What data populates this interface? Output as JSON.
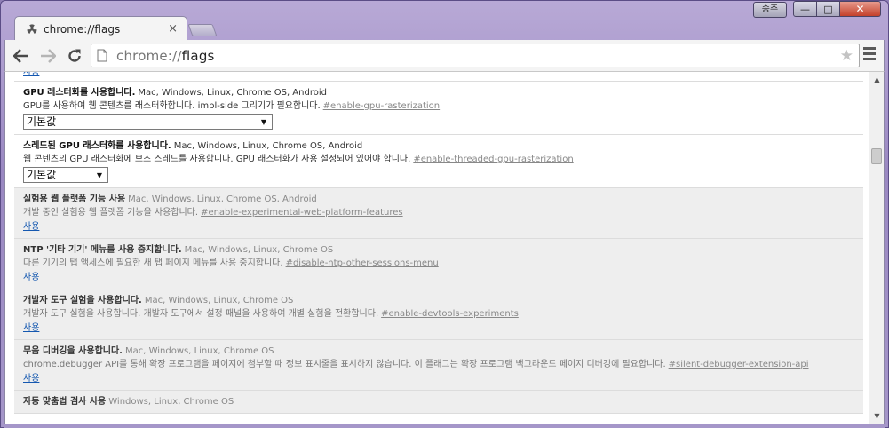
{
  "window": {
    "user_badge": "송주",
    "minimize": "—",
    "maximize": "□",
    "close": "✕"
  },
  "tab": {
    "title": "chrome://flags",
    "close": "×"
  },
  "toolbar": {
    "url_scheme": "chrome://",
    "url_host": "flags"
  },
  "flags": {
    "partial_top_link": "사용",
    "items": [
      {
        "title": "GPU 래스터화를 사용합니다.",
        "platforms": "Mac, Windows, Linux, Chrome OS, Android",
        "description": "GPU를 사용하여 웹 콘텐츠를 래스터화합니다. impl-side 그리기가 필요합니다.",
        "hash": "#enable-gpu-rasterization",
        "control": "select",
        "select_value": "기본값"
      },
      {
        "title": "스레드된 GPU 래스터화를 사용합니다.",
        "platforms": "Mac, Windows, Linux, Chrome OS, Android",
        "description": "웹 콘텐츠의 GPU 래스터화에 보조 스레드를 사용합니다. GPU 래스터화가 사용 설정되어 있어야 합니다.",
        "hash": "#enable-threaded-gpu-rasterization",
        "control": "select",
        "select_value": "기본값"
      },
      {
        "title": "실험용 웹 플랫폼 기능 사용",
        "platforms": "Mac, Windows, Linux, Chrome OS, Android",
        "description": "개발 중인 실험용 웹 플랫폼 기능을 사용합니다.",
        "hash": "#enable-experimental-web-platform-features",
        "control": "link",
        "link_label": "사용"
      },
      {
        "title": "NTP '기타 기기' 메뉴를 사용 중지합니다.",
        "platforms": "Mac, Windows, Linux, Chrome OS",
        "description": "다른 기기의 탭 액세스에 필요한 새 탭 페이지 메뉴를 사용 중지합니다.",
        "hash": "#disable-ntp-other-sessions-menu",
        "control": "link",
        "link_label": "사용"
      },
      {
        "title": "개발자 도구 실험을 사용합니다.",
        "platforms": "Mac, Windows, Linux, Chrome OS",
        "description": "개발자 도구 실험을 사용합니다. 개발자 도구에서 설정 패널을 사용하여 개별 실험을 전환합니다.",
        "hash": "#enable-devtools-experiments",
        "control": "link",
        "link_label": "사용"
      },
      {
        "title": "무음 디버깅을 사용합니다.",
        "platforms": "Mac, Windows, Linux, Chrome OS",
        "description": "chrome.debugger API를 통해 확장 프로그램을 페이지에 첨부할 때 정보 표시줄을 표시하지 않습니다. 이 플래그는 확장 프로그램 백그라운드 페이지 디버깅에 필요합니다.",
        "hash": "#silent-debugger-extension-api",
        "control": "link",
        "link_label": "사용"
      }
    ],
    "partial_bottom_title": "자동 맞춤법 검사 사용",
    "partial_bottom_platforms": "Windows, Linux, Chrome OS"
  }
}
